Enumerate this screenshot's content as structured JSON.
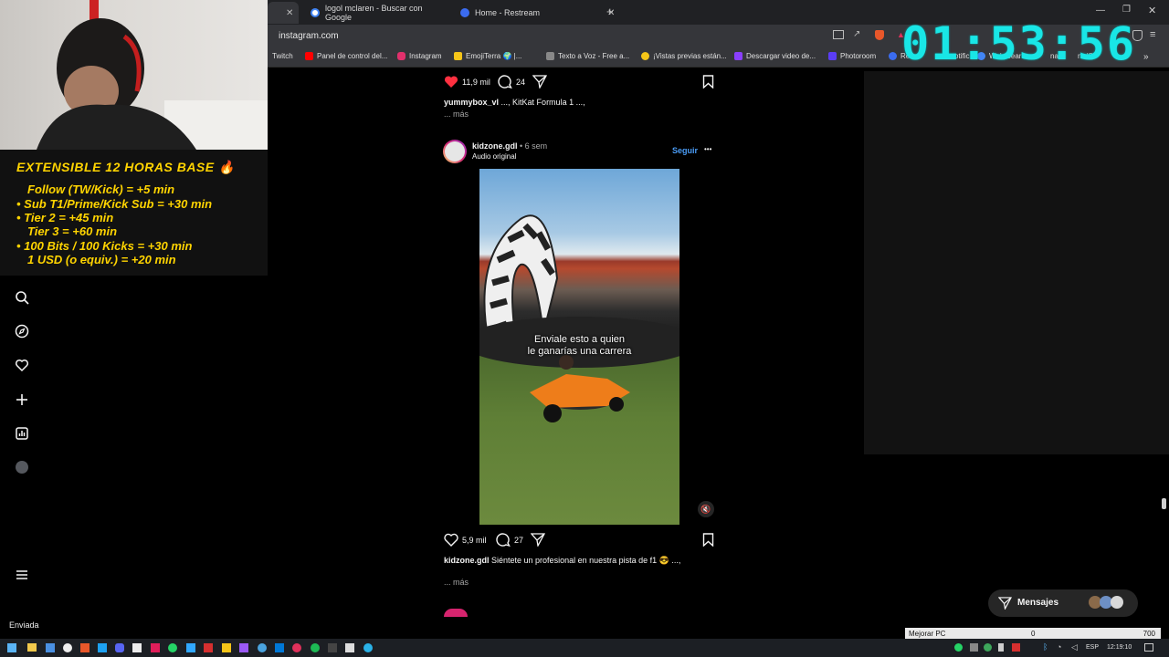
{
  "browser": {
    "tabs": [
      {
        "label": "logol mclaren - Buscar con Google",
        "icon_color": "#4285f4"
      },
      {
        "label": "Home - Restream",
        "icon_color": "#3b6cf0"
      }
    ],
    "url": "instagram.com",
    "bookmarks": [
      {
        "label": "Twitch",
        "icon_color": "#9146ff"
      },
      {
        "label": "Panel de control del...",
        "icon_color": "#ff0000"
      },
      {
        "label": "Instagram",
        "icon_color": "#e1306c"
      },
      {
        "label": "EmojiTerra 🌍 |...",
        "icon_color": "#f5c518"
      },
      {
        "label": "Texto a Voz - Free a...",
        "icon_color": "#888888"
      },
      {
        "label": "¡Vistas previas están...",
        "icon_color": "#f5c518"
      },
      {
        "label": "Descargar video de...",
        "icon_color": "#8a3ffc"
      },
      {
        "label": "Photoroom",
        "icon_color": "#5b3df5"
      },
      {
        "label": "Res",
        "icon_color": "#3b6cf0"
      },
      {
        "label": "otific",
        "icon_color": "#777777"
      },
      {
        "label": "Web Sear",
        "icon_color": "#4285f4"
      },
      {
        "label": "nails",
        "icon_color": "#999999"
      },
      {
        "label": "ne/Gi",
        "icon_color": "#999999"
      }
    ]
  },
  "stream_timer": "01:53:56",
  "overlay": {
    "title": "EXTENSIBLE 12 HORAS BASE 🔥",
    "rules": [
      "Follow (TW/Kick) = +5 min",
      "• Sub T1/Prime/Kick Sub = +30 min",
      "• Tier 2 = +45 min",
      "Tier 3 = +60 min",
      "• 100 Bits / 100 Kicks = +30 min",
      "1 USD (o equiv.) = +20 min"
    ]
  },
  "post1": {
    "likes": "11,9 mil",
    "comments": "24",
    "username": "yummybox_vl",
    "caption": "..., KitKat Formula 1 ...,",
    "more": "... más"
  },
  "post2": {
    "username": "kidzone.gdl",
    "time": "• 6 sem",
    "audio": "Audio original",
    "follow": "Seguir",
    "options": "•••",
    "video_caption_line1": "Enviale esto a quien",
    "video_caption_line2": "le ganarías una carrera",
    "likes": "5,9 mil",
    "comments": "27",
    "caption": "Siéntete un profesional en nuestra pista de f1 😎 ...,",
    "more": "... más"
  },
  "messages_label": "Mensajes",
  "status_left": "Enviada",
  "mejorar": {
    "label": "Mejorar PC",
    "value": "0",
    "max": "700"
  },
  "taskbar": {
    "lang": "ESP",
    "time": "12:19:10"
  }
}
